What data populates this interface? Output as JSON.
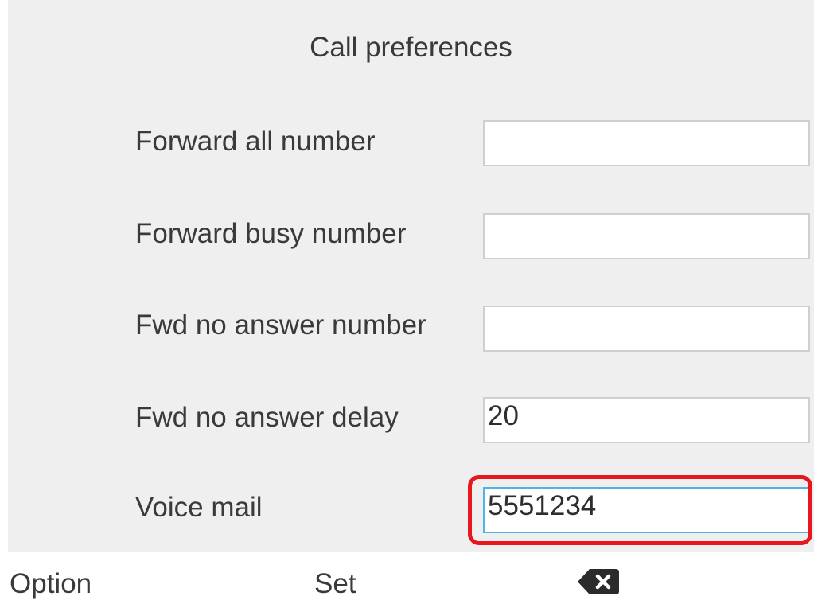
{
  "header": {
    "title": "Call preferences"
  },
  "form": {
    "fields": [
      {
        "label": "Forward all number",
        "value": ""
      },
      {
        "label": "Forward busy number",
        "value": ""
      },
      {
        "label": "Fwd no answer number",
        "value": ""
      },
      {
        "label": "Fwd no answer delay",
        "value": "20"
      },
      {
        "label": "Voice mail",
        "value": "5551234"
      }
    ]
  },
  "softkeys": {
    "option": "Option",
    "set": "Set",
    "backspace_icon": "backspace-icon"
  },
  "colors": {
    "screen_background": "#efefef",
    "highlight": "#e8161d",
    "focus_border": "#4fb3e6"
  }
}
